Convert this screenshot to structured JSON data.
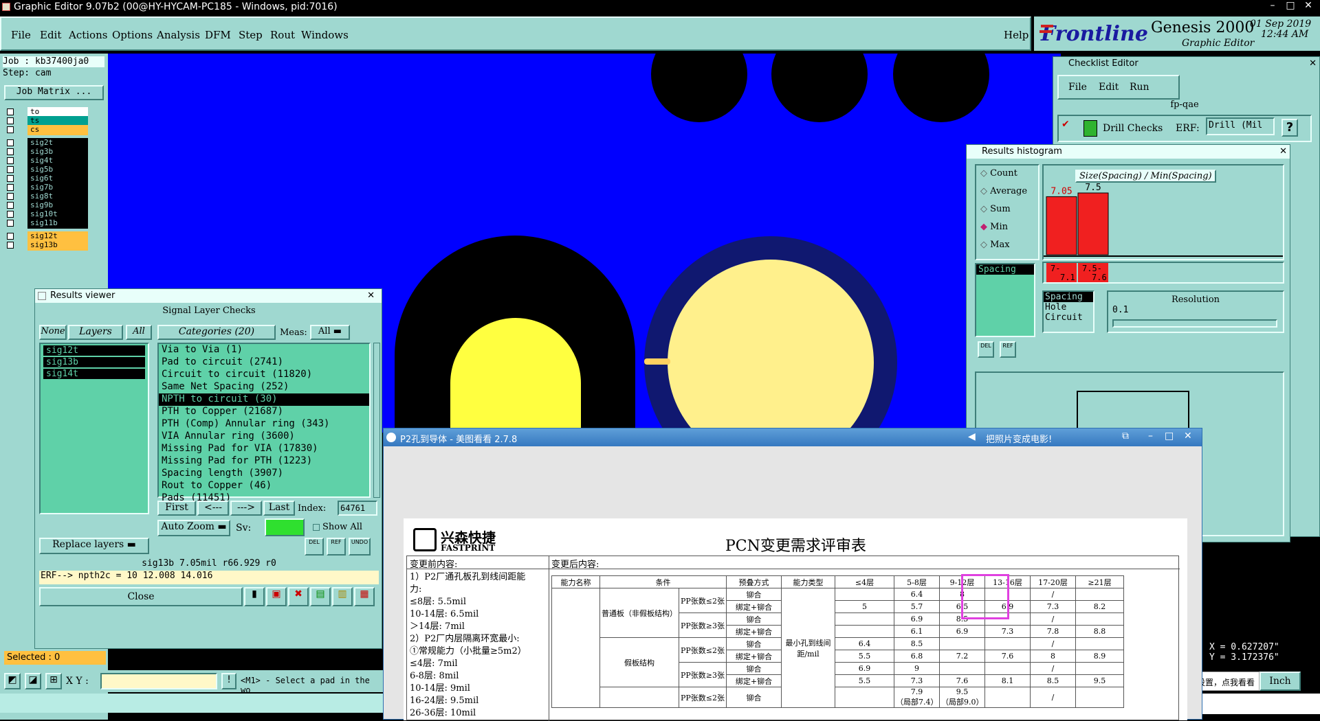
{
  "title_bar": {
    "text": "Graphic Editor 9.07b2 (00@HY-HYCAM-PC185 - Windows, pid:7016)"
  },
  "menu": [
    "File",
    "Edit",
    "Actions",
    "Options",
    "Analysis",
    "DFM",
    "Step",
    "Rout",
    "Windows"
  ],
  "help_label": "Help",
  "brand": {
    "logo": "Frontline",
    "product": "Genesis 2000",
    "subtitle": "Graphic Editor",
    "date": "01 Sep 2019",
    "time": "12:44 AM"
  },
  "job": {
    "job_label": "Job : kb37400ja0",
    "step_label": "Step: cam",
    "matrix_button": "Job Matrix ..."
  },
  "layers": [
    {
      "name": "to",
      "color": "#ffffff"
    },
    {
      "name": "ts",
      "color": "#00a090"
    },
    {
      "name": "cs",
      "color": "#ffc040"
    },
    {
      "name": "sig2t",
      "color": "#000000"
    },
    {
      "name": "sig3b",
      "color": "#000000"
    },
    {
      "name": "sig4t",
      "color": "#000000"
    },
    {
      "name": "sig5b",
      "color": "#000000"
    },
    {
      "name": "sig6t",
      "color": "#000000"
    },
    {
      "name": "sig7b",
      "color": "#000000"
    },
    {
      "name": "sig8t",
      "color": "#000000"
    },
    {
      "name": "sig9b",
      "color": "#000000"
    },
    {
      "name": "sig10t",
      "color": "#000000"
    },
    {
      "name": "sig11b",
      "color": "#000000"
    },
    {
      "name": "sig12t",
      "color": "#ffc040"
    },
    {
      "name": "sig13b",
      "color": "#ffc040"
    }
  ],
  "selected_label": "Selected : 0",
  "xy_label": "X Y :",
  "prompt": "<M1> - Select a pad in the wo",
  "results_viewer": {
    "title": "Results viewer",
    "header": "Signal Layer Checks",
    "none_btn": "None",
    "layers_btn": "Layers",
    "all_btn": "All",
    "categories_btn": "Categories (20)",
    "meas_label": "Meas:",
    "meas_value": "All",
    "layer_list": [
      "sig12t",
      "sig13b",
      "sig14t"
    ],
    "categories": [
      "Via to Via (1)",
      "Pad to circuit (2741)",
      "Circuit to circuit (11820)",
      "Same Net Spacing (252)",
      "NPTH to circuit (30)",
      "PTH to Copper (21687)",
      "PTH (Comp) Annular ring (343)",
      "VIA Annular ring (3600)",
      "Missing Pad for VIA (17830)",
      "Missing Pad for PTH (1223)",
      "Spacing length (3907)",
      "Rout to Copper (46)",
      "Pads (11451)"
    ],
    "selected_category_index": 4,
    "nav": {
      "first": "First",
      "prev": "<---",
      "next": "--->",
      "last": "Last",
      "index_label": "Index:",
      "index_value": "64761"
    },
    "auto_zoom": "Auto Zoom",
    "sv_label": "Sv:",
    "show_all": "Show All",
    "replace_layers": "Replace layers",
    "del": "DEL",
    "ref": "REF",
    "undo": "UNDO",
    "info_line": "sig13b 7.05mil   r66.929  r0",
    "erf_line": "ERF--> npth2c = 10 12.008 14.016",
    "close": "Close"
  },
  "checklist": {
    "title": "Checklist Editor",
    "menu": [
      "File",
      "Edit",
      "Run"
    ],
    "name": "fp-qae",
    "action": "Drill Checks",
    "erf_label": "ERF:",
    "erf_value": "Drill (Mil",
    "help": "?"
  },
  "histogram": {
    "title": "Results histogram",
    "modes": [
      "Count",
      "Average",
      "Sum",
      "Min",
      "Max"
    ],
    "selected_mode": "Min",
    "chart_title": "Size(Spacing) / Min(Spacing)",
    "bars": [
      {
        "value": 7.05,
        "label": "7.05",
        "range": "7-\n7.1"
      },
      {
        "value": 7.5,
        "label": "7.5",
        "range": "7.5-\n7.6"
      }
    ],
    "list_items": [
      "Spacing"
    ],
    "measure_items": [
      "Spacing",
      "Hole",
      "Circuit"
    ],
    "resolution_label": "Resolution",
    "resolution_value": "0.1",
    "del": "DEL",
    "ref": "REF"
  },
  "coords": {
    "x": "X = 0.627207\"",
    "y": "Y = 3.172376\"",
    "units": "Inch"
  },
  "ime_hint": "个性设置，点我看看",
  "viewer": {
    "title": "P2孔到导体 - 美图看看 2.7.8",
    "ad": "把照片变成电影!",
    "logo_cn": "兴森快捷",
    "logo_en": "FASTPRINT",
    "doc_title": "PCN变更需求评审表",
    "before_label": "变更前内容:",
    "after_label": "变更后内容:",
    "before_lines": [
      "1）P2厂通孔板孔到线间距能",
      "力:",
      "≤8层: 5.5mil",
      "10-14层: 6.5mil",
      "＞14层: 7mil",
      "2）P2厂内层隔离环宽最小:",
      "①常规能力（小批量≥5m2）",
      "≤4层: 7mil",
      "6-8层: 8mil",
      "10-14层: 9mil",
      "16-24层: 9.5mil",
      "26-36层: 10mil"
    ],
    "table_header": [
      "能力名称",
      "条件",
      "",
      "预叠方式",
      "能力类型",
      "≤4层",
      "5-8层",
      "9-12层",
      "13-16层",
      "17-20层",
      "≥21层"
    ],
    "group1": "普通板（非假板结构）",
    "group2": "假板结构",
    "pp_le2": "PP张数≤2张",
    "pp_ge3": "PP张数≥3张",
    "riveting": "铆合",
    "bind_rivet": "绑定+铆合",
    "cap_type": "最小孔到线间距/mil",
    "rows": [
      [
        "",
        "",
        "",
        "6.4",
        "8",
        "",
        "/",
        ""
      ],
      [
        "",
        "",
        "5",
        "5.7",
        "6.5",
        "6.9",
        "7.3",
        "8.2"
      ],
      [
        "",
        "",
        "",
        "6.9",
        "8.5",
        "",
        "/",
        ""
      ],
      [
        "",
        "",
        "",
        "6.1",
        "6.9",
        "7.3",
        "7.8",
        "8.8"
      ],
      [
        "",
        "",
        "6.4",
        "8.5",
        "",
        "",
        "/",
        ""
      ],
      [
        "",
        "",
        "5.5",
        "6.8",
        "7.2",
        "7.6",
        "8",
        "8.9"
      ],
      [
        "",
        "",
        "6.9",
        "9",
        "",
        "",
        "/",
        ""
      ],
      [
        "",
        "",
        "5.5",
        "7.3",
        "7.6",
        "8.1",
        "8.5",
        "9.5"
      ],
      [
        "",
        "",
        "",
        "7.9\n（局部7.4）",
        "9.5\n（局部9.0）",
        "",
        "/",
        ""
      ]
    ],
    "dash": "/"
  }
}
